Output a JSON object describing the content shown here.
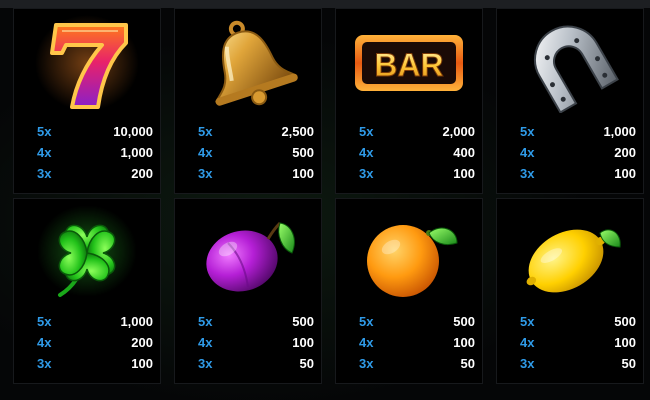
{
  "colors": {
    "multiplier": "#2f9be8",
    "amount": "#ffffff",
    "card_bg": "#000000",
    "page_bg": "#050607"
  },
  "symbols": [
    {
      "icon": "seven-icon",
      "bar_text": "",
      "pays": [
        {
          "mult": "5x",
          "amount": "10,000"
        },
        {
          "mult": "4x",
          "amount": "1,000"
        },
        {
          "mult": "3x",
          "amount": "200"
        }
      ]
    },
    {
      "icon": "bell-icon",
      "bar_text": "",
      "pays": [
        {
          "mult": "5x",
          "amount": "2,500"
        },
        {
          "mult": "4x",
          "amount": "500"
        },
        {
          "mult": "3x",
          "amount": "100"
        }
      ]
    },
    {
      "icon": "bar-icon",
      "bar_text": "BAR",
      "pays": [
        {
          "mult": "5x",
          "amount": "2,000"
        },
        {
          "mult": "4x",
          "amount": "400"
        },
        {
          "mult": "3x",
          "amount": "100"
        }
      ]
    },
    {
      "icon": "horseshoe-icon",
      "bar_text": "",
      "pays": [
        {
          "mult": "5x",
          "amount": "1,000"
        },
        {
          "mult": "4x",
          "amount": "200"
        },
        {
          "mult": "3x",
          "amount": "100"
        }
      ]
    },
    {
      "icon": "clover-icon",
      "bar_text": "",
      "pays": [
        {
          "mult": "5x",
          "amount": "1,000"
        },
        {
          "mult": "4x",
          "amount": "200"
        },
        {
          "mult": "3x",
          "amount": "100"
        }
      ]
    },
    {
      "icon": "plum-icon",
      "bar_text": "",
      "pays": [
        {
          "mult": "5x",
          "amount": "500"
        },
        {
          "mult": "4x",
          "amount": "100"
        },
        {
          "mult": "3x",
          "amount": "50"
        }
      ]
    },
    {
      "icon": "orange-icon",
      "bar_text": "",
      "pays": [
        {
          "mult": "5x",
          "amount": "500"
        },
        {
          "mult": "4x",
          "amount": "100"
        },
        {
          "mult": "3x",
          "amount": "50"
        }
      ]
    },
    {
      "icon": "lemon-icon",
      "bar_text": "",
      "pays": [
        {
          "mult": "5x",
          "amount": "500"
        },
        {
          "mult": "4x",
          "amount": "100"
        },
        {
          "mult": "3x",
          "amount": "50"
        }
      ]
    }
  ]
}
